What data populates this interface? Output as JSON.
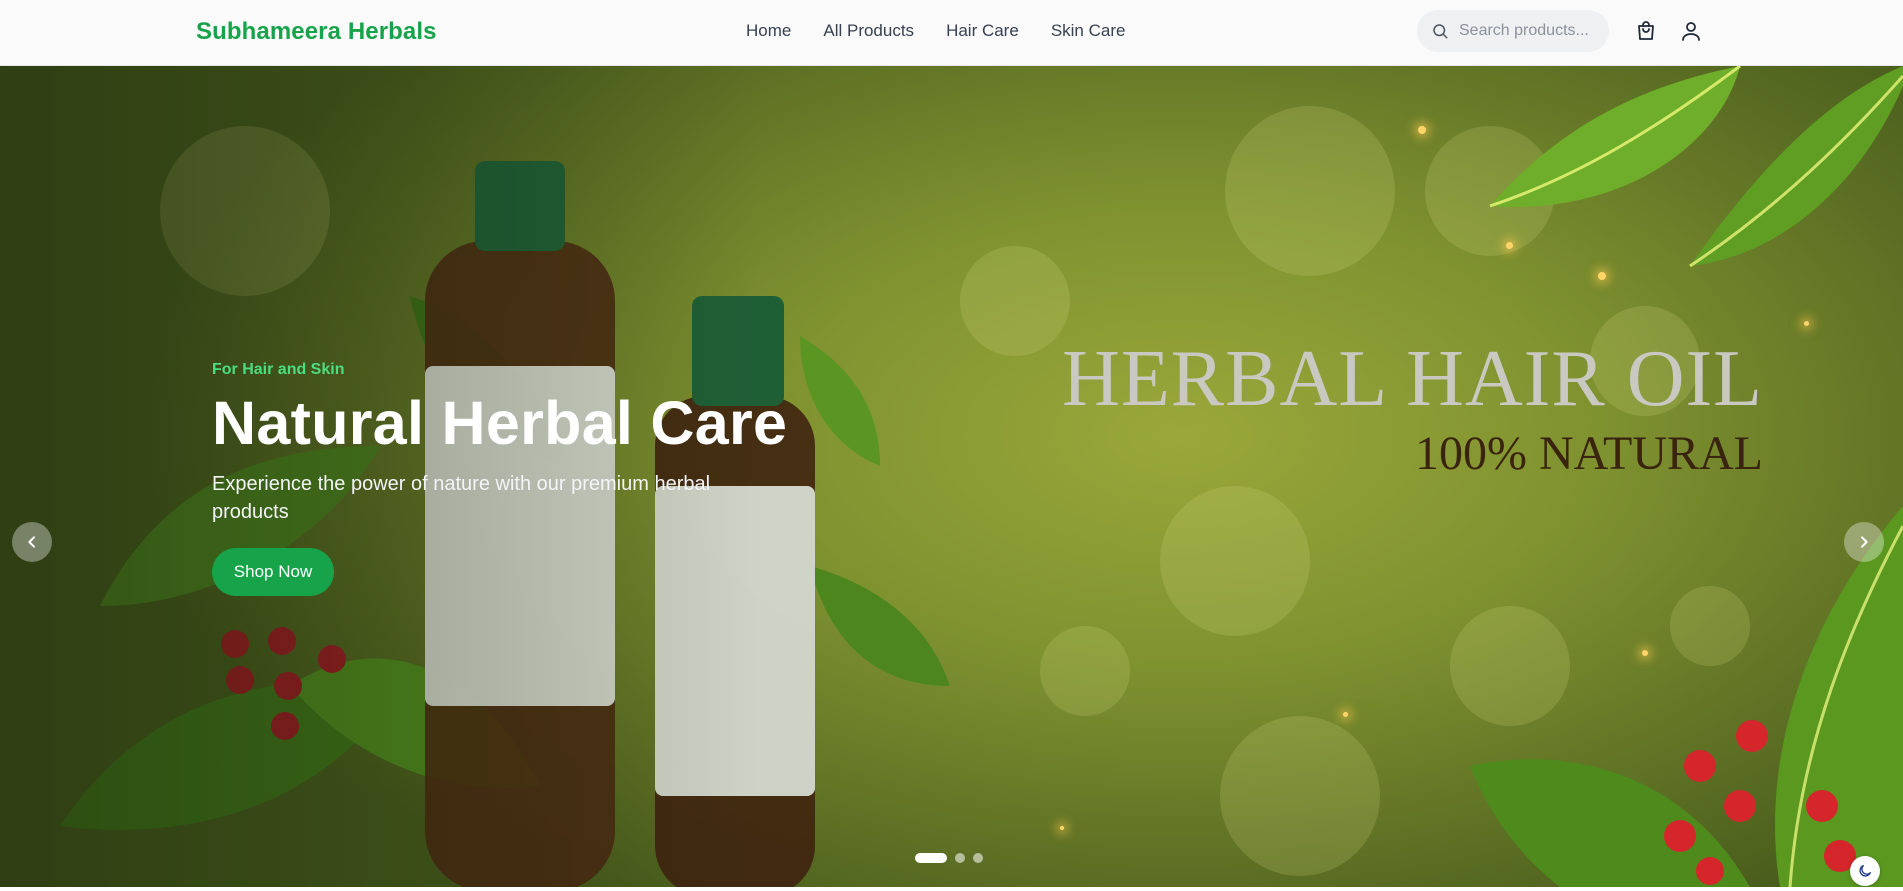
{
  "brand": {
    "name": "Subhameera Herbals"
  },
  "nav": {
    "items": [
      {
        "label": "Home"
      },
      {
        "label": "All Products"
      },
      {
        "label": "Hair Care"
      },
      {
        "label": "Skin Care"
      }
    ]
  },
  "search": {
    "placeholder": "Search products..."
  },
  "hero": {
    "kicker": "For Hair and Skin",
    "title": "Natural Herbal Care",
    "subtitle": "Experience the power of nature with our premium herbal products",
    "cta": "Shop Now",
    "banner_line1": "HERBAL HAIR OIL",
    "banner_line2": "100% NATURAL",
    "slides": {
      "count": 3,
      "active_index": 0
    }
  },
  "icons": {
    "search": "search-icon",
    "cart": "shopping-bag-icon",
    "account": "user-icon",
    "prev": "chevron-left-icon",
    "next": "chevron-right-icon",
    "theme": "moon-icon"
  },
  "colors": {
    "brand": "#16a34a",
    "kicker": "#4ade80"
  }
}
